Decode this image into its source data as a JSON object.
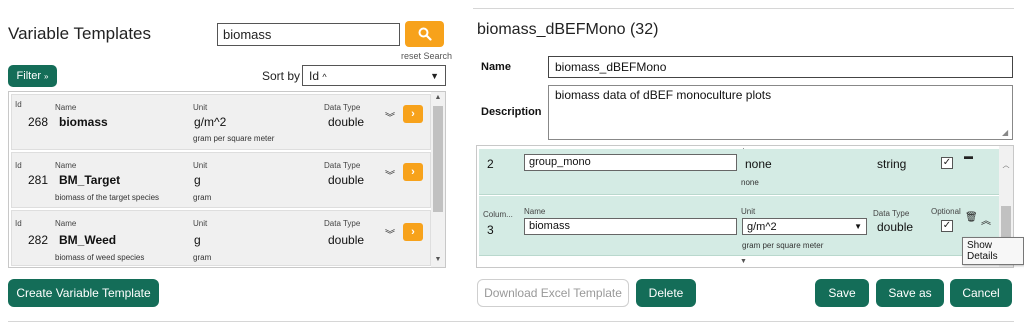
{
  "left": {
    "title": "Variable Templates",
    "search_value": "biomass",
    "reset_search": "reset Search",
    "filter_label": "Filter",
    "sort_label": "Sort by",
    "sort_value": "Id",
    "create_button": "Create Variable Template",
    "headers": {
      "id": "Id",
      "name": "Name",
      "unit": "Unit",
      "data_type": "Data Type"
    },
    "items": [
      {
        "id": "268",
        "name": "biomass",
        "unit": "g/m^2",
        "unit_desc": "gram per square meter",
        "description": "",
        "data_type": "double"
      },
      {
        "id": "281",
        "name": "BM_Target",
        "unit": "g",
        "unit_desc": "gram",
        "description": "biomass of the target species",
        "data_type": "double"
      },
      {
        "id": "282",
        "name": "BM_Weed",
        "unit": "g",
        "unit_desc": "gram",
        "description": "biomass of weed species",
        "data_type": "double"
      }
    ]
  },
  "right": {
    "title": "biomass_dBEFMono (32)",
    "name_label": "Name",
    "name_value": "biomass_dBEFMono",
    "description_label": "Description",
    "description_value": "biomass data of dBEF monoculture plots",
    "columns": [
      {
        "index": "2",
        "name": "group_mono",
        "unit": "none",
        "unit_desc": "none",
        "data_type": "string"
      },
      {
        "index": "3",
        "label": "Colum...",
        "name_label": "Name",
        "name": "biomass",
        "unit_label": "Unit",
        "unit": "g/m^2",
        "unit_desc": "gram per square meter",
        "data_type_label": "Data Type",
        "data_type": "double",
        "optional_label": "Optional"
      }
    ],
    "tooltip": "Show Details",
    "buttons": {
      "download": "Download Excel Template",
      "delete": "Delete",
      "save": "Save",
      "save_as": "Save as",
      "cancel": "Cancel"
    }
  },
  "colors": {
    "accent_green": "#146d58",
    "accent_orange": "#f7a21b",
    "row_green": "#d4ebe4"
  }
}
